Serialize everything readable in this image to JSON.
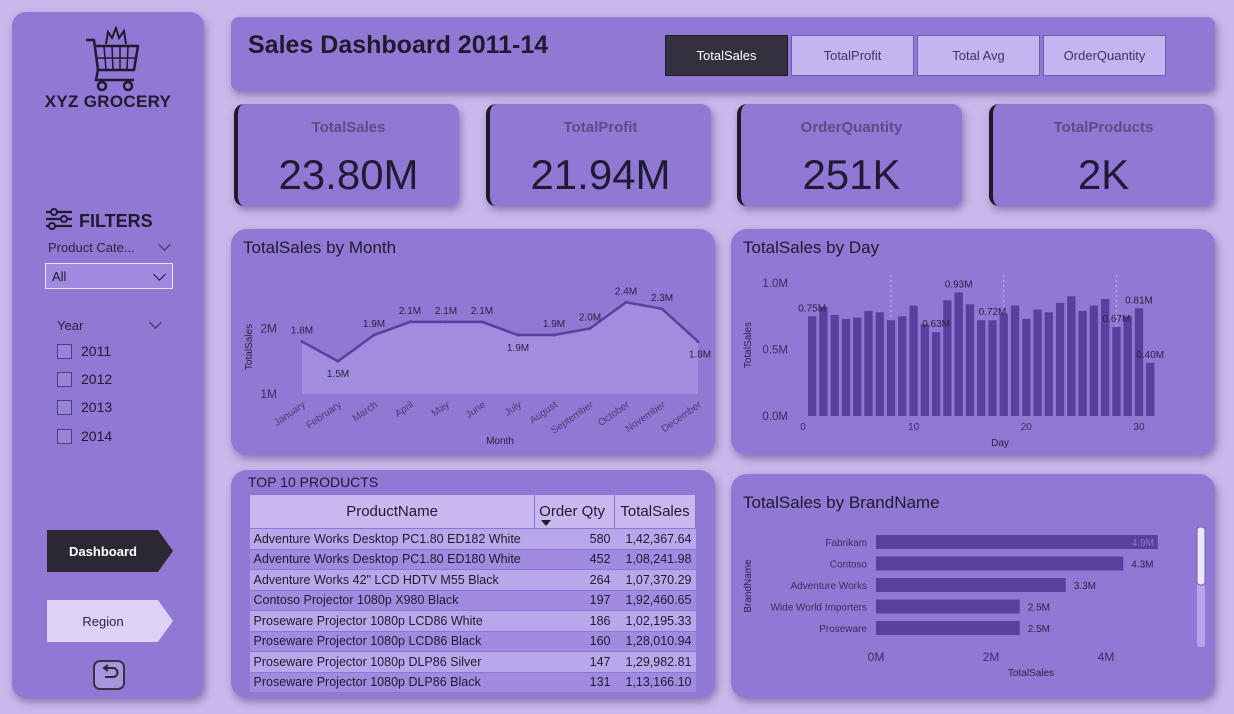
{
  "sidebar": {
    "brand": "XYZ GROCERY",
    "filters_label": "FILTERS",
    "category_label": "Product Cate...",
    "category_value": "All",
    "year_label": "Year",
    "years": [
      "2011",
      "2012",
      "2013",
      "2014"
    ],
    "nav_dashboard": "Dashboard",
    "nav_region": "Region"
  },
  "header": {
    "title": "Sales Dashboard 2011-14",
    "tabs": [
      "TotalSales",
      "TotalProfit",
      "Total Avg",
      "OrderQuantity"
    ],
    "active_tab": "TotalSales"
  },
  "kpis": [
    {
      "label": "TotalSales",
      "value": "23.80M"
    },
    {
      "label": "TotalProfit",
      "value": "21.94M"
    },
    {
      "label": "OrderQuantity",
      "value": "251K"
    },
    {
      "label": "TotalProducts",
      "value": "2K"
    }
  ],
  "colors": {
    "background": "#c9b8ea",
    "panel": "#9078d4",
    "bar": "#5b3f9e",
    "line": "#5b3f9e",
    "active_tab": "#343040"
  },
  "chart_data": [
    {
      "type": "area",
      "title": "TotalSales by Month",
      "xlabel": "Month",
      "ylabel": "TotalSales",
      "categories": [
        "January",
        "February",
        "March",
        "April",
        "May",
        "June",
        "July",
        "August",
        "September",
        "October",
        "November",
        "December"
      ],
      "values": [
        1.8,
        1.5,
        1.9,
        2.1,
        2.1,
        2.1,
        1.9,
        1.9,
        2.0,
        2.4,
        2.3,
        1.8
      ],
      "data_labels": [
        "1.8M",
        "1.5M",
        "1.9M",
        "2.1M",
        "2.1M",
        "2.1M",
        "1.9M",
        "1.9M",
        "2.0M",
        "2.4M",
        "2.3M",
        "1.8M"
      ],
      "yticks": [
        "1M",
        "2M"
      ],
      "ylim": [
        1.0,
        2.45
      ]
    },
    {
      "type": "bar",
      "title": "TotalSales by Day",
      "xlabel": "Day",
      "ylabel": "TotalSales",
      "x": [
        1,
        2,
        3,
        4,
        5,
        6,
        7,
        8,
        9,
        10,
        11,
        12,
        13,
        14,
        15,
        16,
        17,
        18,
        19,
        20,
        21,
        22,
        23,
        24,
        25,
        26,
        27,
        28,
        29,
        30,
        31
      ],
      "values": [
        0.75,
        0.82,
        0.76,
        0.73,
        0.74,
        0.79,
        0.78,
        0.72,
        0.75,
        0.83,
        0.69,
        0.63,
        0.87,
        0.93,
        0.84,
        0.72,
        0.72,
        0.77,
        0.83,
        0.73,
        0.8,
        0.78,
        0.85,
        0.9,
        0.79,
        0.83,
        0.88,
        0.67,
        0.75,
        0.81,
        0.4
      ],
      "data_labels": [
        {
          "day": 1,
          "text": "0.75M"
        },
        {
          "day": 12,
          "text": "0.63M"
        },
        {
          "day": 14,
          "text": "0.93M"
        },
        {
          "day": 17,
          "text": "0.72M"
        },
        {
          "day": 28,
          "text": "0.67M"
        },
        {
          "day": 30,
          "text": "0.81M"
        },
        {
          "day": 31,
          "text": "0.40M"
        }
      ],
      "yticks": [
        "0.0M",
        "0.5M",
        "1.0M"
      ],
      "xticks": [
        "0",
        "10",
        "20",
        "30"
      ],
      "ylim": [
        0,
        1.0
      ]
    },
    {
      "type": "bar",
      "orientation": "horizontal",
      "title": "TotalSales by BrandName",
      "xlabel": "TotalSales",
      "ylabel": "BrandName",
      "categories": [
        "Fabrikam",
        "Contoso",
        "Adventure Works",
        "Wide World Importers",
        "Proseware"
      ],
      "values": [
        4.9,
        4.3,
        3.3,
        2.5,
        2.5
      ],
      "data_labels": [
        "4.9M",
        "4.3M",
        "3.3M",
        "2.5M",
        "2.5M"
      ],
      "xticks": [
        "0M",
        "2M",
        "4M"
      ],
      "xlim": [
        0,
        5.0
      ]
    }
  ],
  "top10": {
    "title": "TOP 10 PRODUCTS",
    "columns": [
      "ProductName",
      "Order Qty",
      "TotalSales"
    ],
    "rows": [
      [
        "Adventure Works Desktop PC1.80 ED182 White",
        "580",
        "1,42,367.64"
      ],
      [
        "Adventure Works Desktop PC1.80 ED180 White",
        "452",
        "1,08,241.98"
      ],
      [
        "Adventure Works 42\" LCD HDTV M55 Black",
        "264",
        "1,07,370.29"
      ],
      [
        "Contoso Projector 1080p X980 Black",
        "197",
        "1,92,460.65"
      ],
      [
        "Proseware Projector 1080p LCD86 White",
        "186",
        "1,02,195.33"
      ],
      [
        "Proseware Projector 1080p LCD86 Black",
        "160",
        "1,28,010.94"
      ],
      [
        "Proseware Projector 1080p DLP86 Silver",
        "147",
        "1,29,982.81"
      ],
      [
        "Proseware Projector 1080p DLP86 Black",
        "131",
        "1,13,166.10"
      ]
    ]
  }
}
